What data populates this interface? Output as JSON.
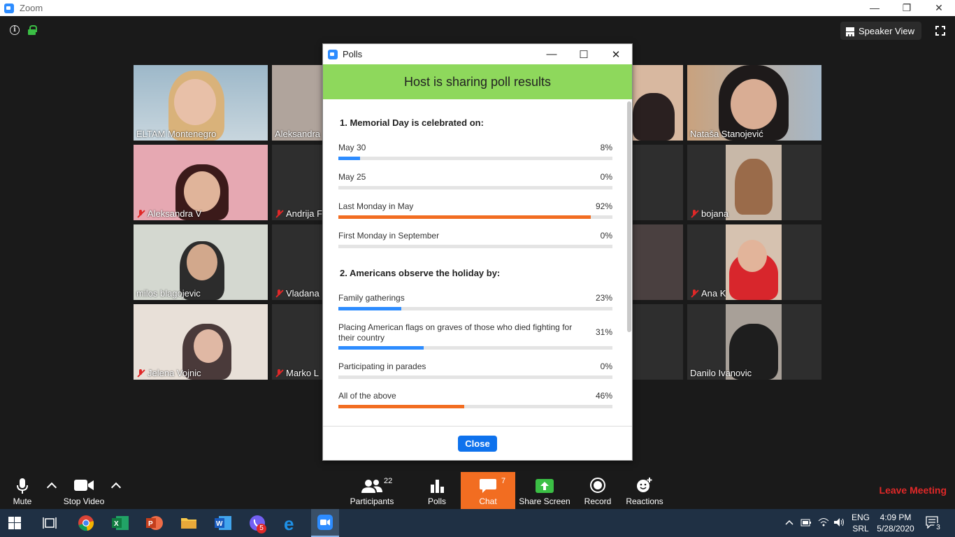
{
  "window": {
    "title": "Zoom",
    "minimize": "—",
    "restore": "❐",
    "close": "✕"
  },
  "meeting": {
    "speaker_view_label": "Speaker View",
    "participants": [
      {
        "name": "ELTAM Montenegro",
        "muted": false
      },
      {
        "name": "Aleksandra",
        "muted": false
      },
      {
        "name": "Nataša Stanojević",
        "muted": false
      },
      {
        "name": "Aleksandra V",
        "muted": true
      },
      {
        "name": "Andrija F",
        "muted": true
      },
      {
        "name": "bojana",
        "muted": true
      },
      {
        "name": "milos blagojevic",
        "muted": false
      },
      {
        "name": "Vladana",
        "muted": true
      },
      {
        "name": "Ana K",
        "muted": true
      },
      {
        "name": "Jelena Vojnic",
        "muted": true
      },
      {
        "name": "Marko L",
        "muted": true
      },
      {
        "name": "Danilo Ivanovic",
        "muted": false
      }
    ]
  },
  "polls": {
    "title": "Polls",
    "controls": {
      "minimize": "—",
      "maximize": "☐",
      "close": "✕"
    },
    "banner": "Host is sharing poll results",
    "questions": [
      {
        "title": "1. Memorial Day is celebrated on:",
        "answers": [
          {
            "label": "May 30",
            "percent": "8%",
            "value": 8,
            "color": "#2d8cff"
          },
          {
            "label": "May 25",
            "percent": "0%",
            "value": 0,
            "color": "#2d8cff"
          },
          {
            "label": "Last Monday in May",
            "percent": "92%",
            "value": 92,
            "color": "#f26d21"
          },
          {
            "label": "First Monday in September",
            "percent": "0%",
            "value": 0,
            "color": "#2d8cff"
          }
        ]
      },
      {
        "title": "2. Americans observe the holiday by:",
        "answers": [
          {
            "label": "Family gatherings",
            "percent": "23%",
            "value": 23,
            "color": "#2d8cff"
          },
          {
            "label": "Placing American flags on graves of those who died fighting for their country",
            "percent": "31%",
            "value": 31,
            "color": "#2d8cff"
          },
          {
            "label": "Participating in parades",
            "percent": "0%",
            "value": 0,
            "color": "#2d8cff"
          },
          {
            "label": "All of the above",
            "percent": "46%",
            "value": 46,
            "color": "#f26d21"
          }
        ]
      }
    ],
    "close_label": "Close"
  },
  "toolbar": {
    "mute": "Mute",
    "stop_video": "Stop Video",
    "participants": "Participants",
    "participants_count": "22",
    "polls": "Polls",
    "chat": "Chat",
    "chat_count": "7",
    "share_screen": "Share Screen",
    "record": "Record",
    "reactions": "Reactions",
    "leave": "Leave Meeting"
  },
  "taskbar": {
    "apps": [
      "windows-start",
      "task-view",
      "chrome",
      "excel",
      "powerpoint",
      "file-explorer",
      "word",
      "viber",
      "edge",
      "zoom"
    ],
    "viber_badge": "5",
    "lang_top": "ENG",
    "lang_bottom": "SRL",
    "time": "4:09 PM",
    "date": "5/28/2020",
    "notifications": "3"
  },
  "colors": {
    "accent": "#2d8cff",
    "banner": "#8ed85c",
    "leave": "#e02828",
    "chat_active": "#f26d21"
  }
}
